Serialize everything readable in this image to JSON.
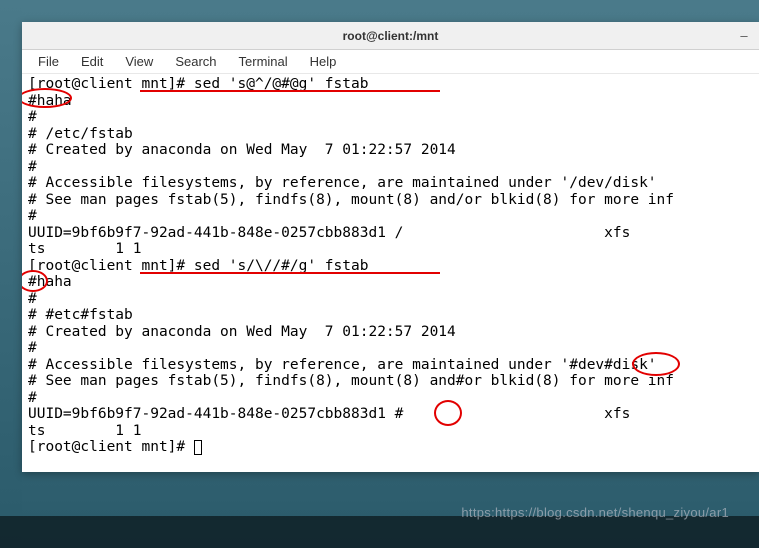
{
  "window": {
    "title": "root@client:/mnt"
  },
  "menu": {
    "file": "File",
    "edit": "Edit",
    "view": "View",
    "search": "Search",
    "terminal": "Terminal",
    "help": "Help"
  },
  "terminal": {
    "l01": "[root@client mnt]# sed 's@^/@#@g' fstab",
    "l02": "#haha",
    "l03": "#",
    "l04": "# /etc/fstab",
    "l05": "# Created by anaconda on Wed May  7 01:22:57 2014",
    "l06": "#",
    "l07": "# Accessible filesystems, by reference, are maintained under '/dev/disk'",
    "l08": "# See man pages fstab(5), findfs(8), mount(8) and/or blkid(8) for more inf",
    "l09": "#",
    "l10": "UUID=9bf6b9f7-92ad-441b-848e-0257cbb883d1 /                       xfs",
    "l11": "ts        1 1",
    "l12": "[root@client mnt]# sed 's/\\//#/g' fstab",
    "l13": "#haha",
    "l14": "#",
    "l15": "# #etc#fstab",
    "l16": "# Created by anaconda on Wed May  7 01:22:57 2014",
    "l17": "#",
    "l18": "# Accessible filesystems, by reference, are maintained under '#dev#disk'",
    "l19": "# See man pages fstab(5), findfs(8), mount(8) and#or blkid(8) for more inf",
    "l20": "#",
    "l21": "UUID=9bf6b9f7-92ad-441b-848e-0257cbb883d1 #                       xfs",
    "l22": "ts        1 1",
    "l23": "[root@client mnt]# "
  },
  "watermark": "https:https://blog.csdn.net/shenqu_ziyou/ar1",
  "annotations_note": "red circles and underlines highlight: #haha (line2), underline on sed command line1 args, #h on line13, underline on sed command line12 args, #dev# on line18, # on line21"
}
